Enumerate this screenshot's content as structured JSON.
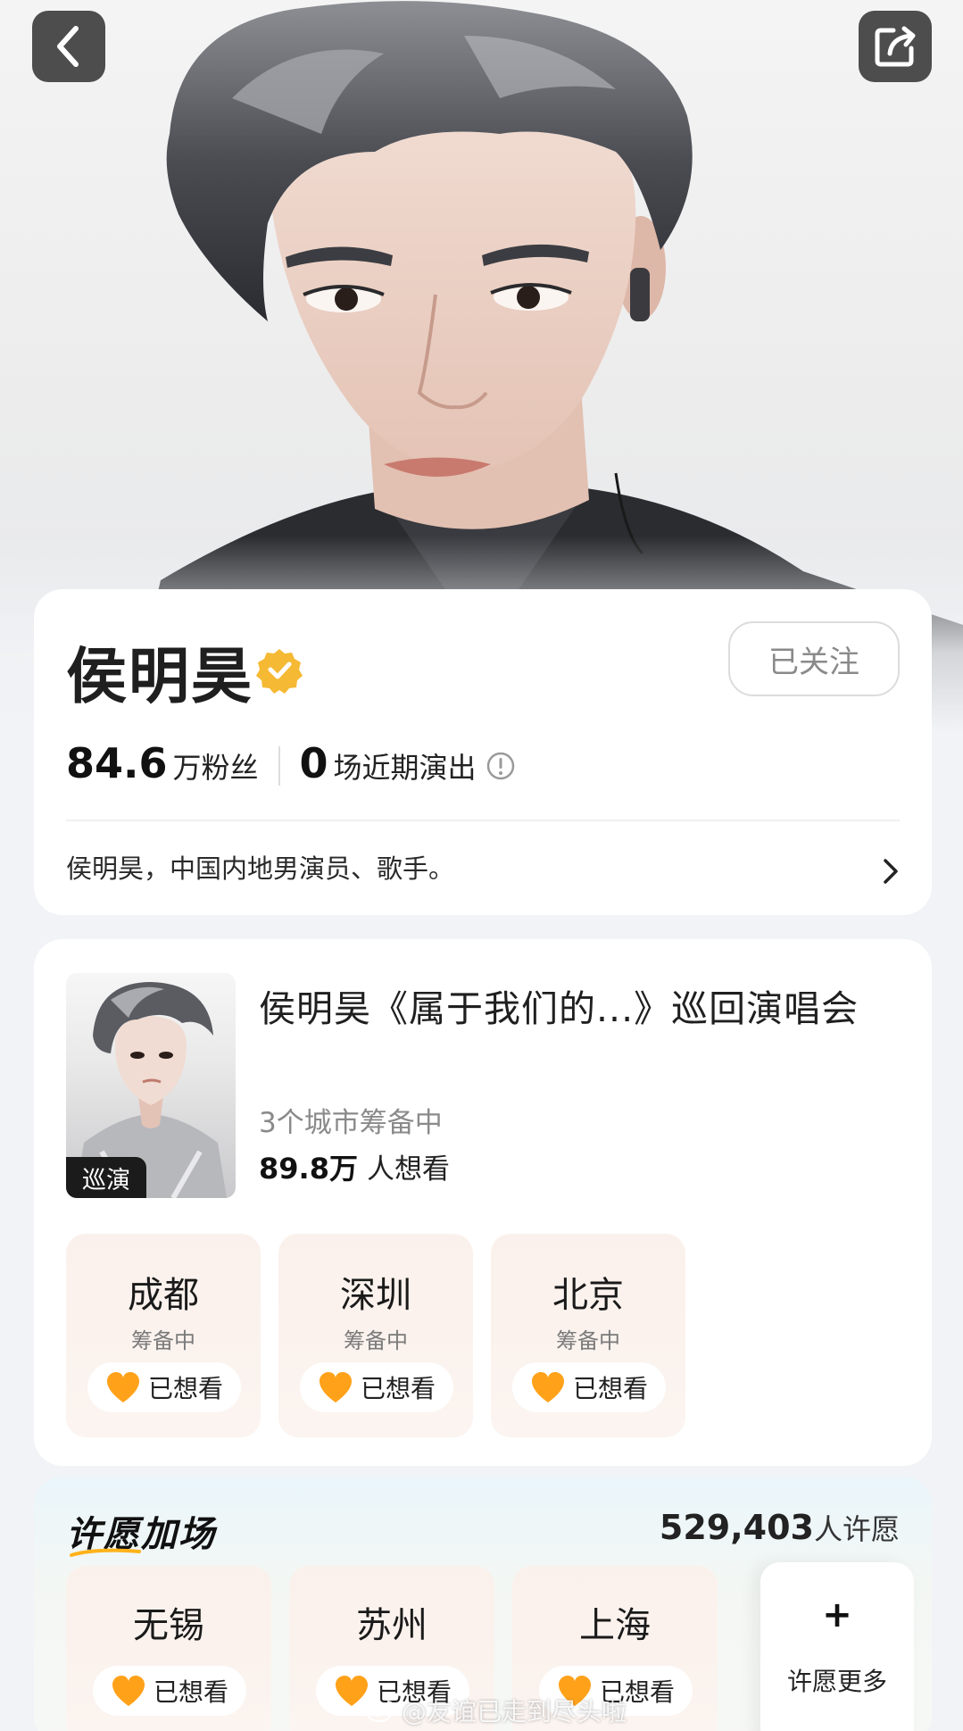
{
  "nav": {
    "back_icon": "chevron-left-icon",
    "share_icon": "share-icon"
  },
  "profile": {
    "name": "侯明昊",
    "verified_icon": "verified-badge-icon",
    "follow_label": "已关注",
    "fans_num": "84.6",
    "fans_label": "万粉丝",
    "shows_num": "0",
    "shows_label": "场近期演出",
    "bio": "侯明昊，中国内地男演员、歌手。"
  },
  "tour": {
    "poster_badge": "巡演",
    "title": "侯明昊《属于我们的...》巡回演唱会",
    "cities_status": "3个城市筹备中",
    "want_num": "89.8万",
    "want_label": "人想看",
    "cities": [
      {
        "name": "成都",
        "status": "筹备中",
        "want_label": "已想看"
      },
      {
        "name": "深圳",
        "status": "筹备中",
        "want_label": "已想看"
      },
      {
        "name": "北京",
        "status": "筹备中",
        "want_label": "已想看"
      }
    ]
  },
  "wish": {
    "title": "许愿加场",
    "count_num": "529,403",
    "count_label": "人许愿",
    "cities": [
      {
        "name": "无锡",
        "want_label": "已想看"
      },
      {
        "name": "苏州",
        "want_label": "已想看"
      },
      {
        "name": "上海",
        "want_label": "已想看"
      }
    ],
    "more_plus": "+",
    "more_label": "许愿更多"
  },
  "watermark": "@友谊已走到尽头啦",
  "colors": {
    "accent_heart": "#ffa21a",
    "verified_gold": "#f5b934"
  }
}
